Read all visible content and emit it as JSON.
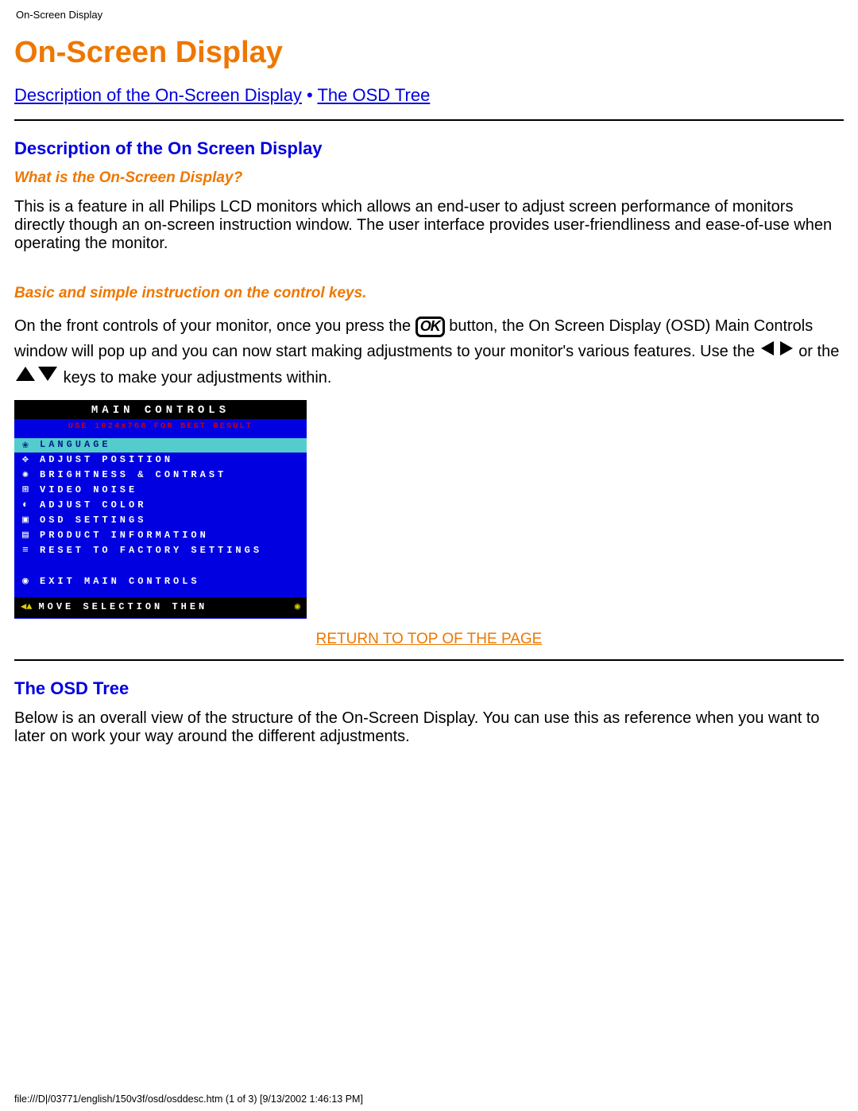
{
  "header": {
    "small": "On-Screen Display"
  },
  "title": "On-Screen Display",
  "toplinks": {
    "desc": "Description of the On-Screen Display",
    "sep": " • ",
    "tree": "The OSD Tree"
  },
  "section1": {
    "heading": "Description of the On Screen Display",
    "sub1": "What is the On-Screen Display?",
    "para1": "This is a feature in all Philips LCD monitors which allows an end-user to adjust screen performance of monitors directly though an on-screen instruction window. The user interface provides user-friendliness and ease-of-use when operating the monitor.",
    "sub2": "Basic and simple instruction on the control keys.",
    "p2a": "On the front controls of your monitor, once you press the ",
    "ok": "OK",
    "p2b": " button, the On Screen Display (OSD) Main Controls window will pop up and you can now start making adjustments to your monitor's various features. Use the ",
    "p2c": " or the ",
    "p2d": " keys to make your adjustments within."
  },
  "osd": {
    "title": "MAIN CONTROLS",
    "sub": "USE 1024x768 FOR BEST RESULT",
    "items": [
      {
        "label": "LANGUAGE",
        "icon": "❀",
        "selected": true
      },
      {
        "label": "ADJUST POSITION",
        "icon": "✥",
        "selected": false
      },
      {
        "label": "BRIGHTNESS & CONTRAST",
        "icon": "✺",
        "selected": false
      },
      {
        "label": "VIDEO NOISE",
        "icon": "⊞",
        "selected": false
      },
      {
        "label": "ADJUST COLOR",
        "icon": "◐",
        "selected": false
      },
      {
        "label": "OSD SETTINGS",
        "icon": "▣",
        "selected": false
      },
      {
        "label": "PRODUCT INFORMATION",
        "icon": "▤",
        "selected": false
      },
      {
        "label": "RESET TO FACTORY SETTINGS",
        "icon": "≡",
        "selected": false
      }
    ],
    "exit": {
      "label": "EXIT MAIN CONTROLS",
      "icon": "◉"
    },
    "footer": "MOVE SELECTION THEN"
  },
  "return_link": "RETURN TO TOP OF THE PAGE",
  "section2": {
    "heading": "The OSD Tree",
    "para": "Below is an overall view of the structure of the On-Screen Display. You can use this as reference when you want to later on work your way around the different adjustments."
  },
  "footer_path": "file:///D|/03771/english/150v3f/osd/osddesc.htm (1 of 3) [9/13/2002 1:46:13 PM]"
}
